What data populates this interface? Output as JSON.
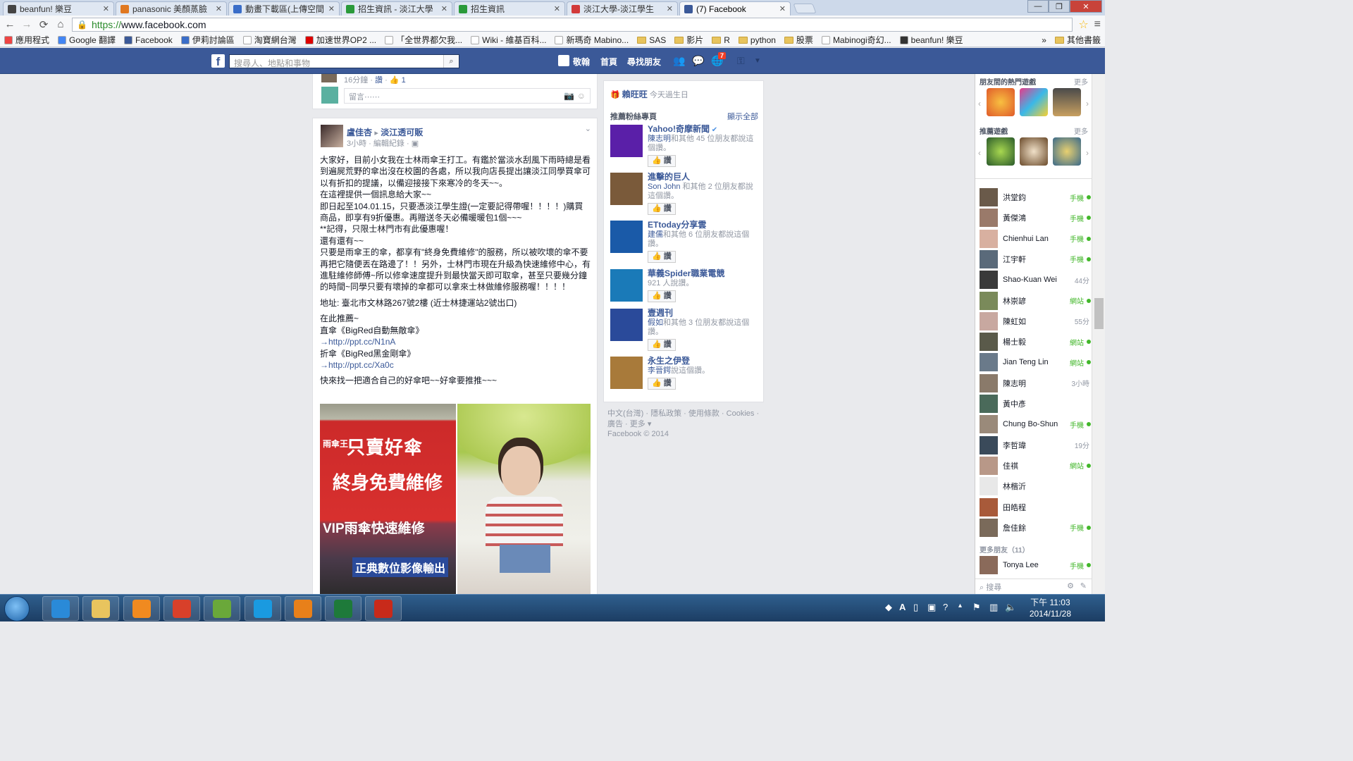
{
  "browser": {
    "tabs": [
      {
        "title": "beanfun! 樂豆",
        "color": "#444"
      },
      {
        "title": "panasonic 美顏蒸臉",
        "color": "#e07820"
      },
      {
        "title": "動畫下載區(上傳空間",
        "color": "#3a6dc8"
      },
      {
        "title": "招生資訊 - 淡江大學",
        "color": "#2a9a3a"
      },
      {
        "title": "招生資訊",
        "color": "#2a9a3a"
      },
      {
        "title": "淡江大學-淡江學生",
        "color": "#d23a3a"
      },
      {
        "title": "(7) Facebook",
        "color": "#3b5998"
      }
    ],
    "url_https": "https://",
    "url_rest": "www.facebook.com",
    "window_buttons": [
      "—",
      "❐",
      "✕"
    ],
    "bookmarks": [
      {
        "label": "應用程式",
        "icon": "apps-icon"
      },
      {
        "label": "Google 翻譯",
        "icon": "google-translate-icon"
      },
      {
        "label": "Facebook",
        "icon": "facebook-icon"
      },
      {
        "label": "伊莉討論區",
        "icon": "eyny-icon"
      },
      {
        "label": "淘寶網台灣",
        "icon": "page-icon"
      },
      {
        "label": "加速世界OP2 ...",
        "icon": "youtube-icon"
      },
      {
        "label": "「全世界都欠我...",
        "icon": "page-icon"
      },
      {
        "label": "Wiki - 維基百科...",
        "icon": "wiki-icon"
      },
      {
        "label": "新瑪奇 Mabino...",
        "icon": "page-icon"
      },
      {
        "label": "SAS",
        "icon": "folder-icon"
      },
      {
        "label": "影片",
        "icon": "folder-icon"
      },
      {
        "label": "R",
        "icon": "folder-icon"
      },
      {
        "label": "python",
        "icon": "folder-icon"
      },
      {
        "label": "股票",
        "icon": "folder-icon"
      },
      {
        "label": "Mabinogi奇幻...",
        "icon": "page-icon"
      },
      {
        "label": "beanfun! 樂豆",
        "icon": "beanfun-icon"
      }
    ],
    "bookmarks_more": "»",
    "other_bookmarks": "其他書籤"
  },
  "fb": {
    "search_placeholder": "搜尋人、地點和事物",
    "nav_user": "敬翰",
    "nav_home": "首頁",
    "nav_find_friends": "尋找朋友",
    "notif_count": "7"
  },
  "prev_post": {
    "time": "16分鐘",
    "like": "讚",
    "like_count": "1",
    "comment_placeholder": "留言⋯⋯"
  },
  "post": {
    "author": "盧佳杏",
    "arrow": "▸",
    "group": "淡江透可販",
    "time": "3小時",
    "edited": "編輯紀錄",
    "paragraphs": [
      "大家好，目前小女我在士林雨傘王打工。有鑑於當淡水刮風下雨時總是看到遍屍荒野的傘出沒在校園的各處，所以我向店長提出讓淡江同學買傘可以有折扣的提議，以備迎接接下來寒冷的冬天~~。",
      "在這裡提供一個訊息給大家~~",
      "即日起至104.01.15，只要憑淡江學生證(一定要記得帶喔！！！！)購買商品，即享有9折優惠。再贈送冬天必備暖暖包1個~~~",
      "**記得，只限士林門市有此優惠喔！",
      "還有還有~~",
      "只要是雨傘王的傘，都享有\"終身免費維修\"的服務，所以被吹壞的傘不要再把它隨便丟在路邊了！！另外，士林門市現在升級為快速維修中心，有進駐維修師傅~所以修傘速度提升到最快當天即可取傘，甚至只要幾分鐘的時間~同學只要有壞掉的傘都可以拿來士林做維修服務喔！！！！"
    ],
    "address": "地址: 臺北市文林路267號2樓 (近士林捷運站2號出口)",
    "recommend": "在此推薦~",
    "item1": "直傘《BigRed自動無敵傘》",
    "link1": "→http://ppt.cc/N1nA",
    "item2": "折傘《BigRed黑金剛傘》",
    "link2": "→http://ppt.cc/Xa0c",
    "closing": "快來找一把適合自己的好傘吧~~好傘要推推~~~",
    "photo_sign_lines": [
      "只賣好傘",
      "終身免費維修",
      "VIP雨傘快速維修",
      "正典數位影像輸出"
    ],
    "photo_sign_brand": "雨傘王"
  },
  "sidebar": {
    "birthday_name": "賴旺旺",
    "birthday_text": "今天過生日",
    "pages_header": "推薦粉絲專頁",
    "show_all": "顯示全部",
    "like_label": "讚",
    "pages": [
      {
        "name": "Yahoo!奇摩新聞",
        "desc_a": "陳志明",
        "desc_b": "和其他 45 位朋友都說這個讚。",
        "color": "#5a1fa8",
        "verified": true
      },
      {
        "name": "進擊的巨人",
        "desc_a": "Son John",
        "desc_b": " 和其他 2 位朋友都說這個讚。",
        "color": "#7a5a3a",
        "verified": false
      },
      {
        "name": "ETtoday分享雲",
        "desc_a": "建儒",
        "desc_b": "和其他 6 位朋友都說這個讚。",
        "color": "#1a5aa8",
        "verified": false
      },
      {
        "name": "華義Spider職業電競",
        "desc_a": "",
        "desc_b": "921 人說讚。",
        "color": "#1a7ab8",
        "verified": false
      },
      {
        "name": "壹週刊",
        "desc_a": "假如",
        "desc_b": "和其他 3 位朋友都說這個讚。",
        "color": "#2a4a9a",
        "verified": false
      },
      {
        "name": "永生之伊登",
        "desc_a": "李晉鍔",
        "desc_b": "說這個讚。",
        "color": "#a87a3a",
        "verified": false
      }
    ]
  },
  "footer": {
    "line1": "中文(台灣) · 隱私政策 · 使用條款 · Cookies ·",
    "line2": "廣告 · 更多 ▾",
    "line3": "Facebook © 2014"
  },
  "chat": {
    "games_header": "朋友間的熱門遊戲",
    "games_more": "更多",
    "rec_games_header": "推薦遊戲",
    "rec_games_more": "更多",
    "friends": [
      {
        "name": "洪堂鈞",
        "status": "手機",
        "active": true
      },
      {
        "name": "黃傑鴻",
        "status": "手機",
        "active": true
      },
      {
        "name": "Chienhui Lan",
        "status": "手機",
        "active": true
      },
      {
        "name": "江宇軒",
        "status": "手機",
        "active": true
      },
      {
        "name": "Shao-Kuan Wei",
        "status": "44分",
        "active": false
      },
      {
        "name": "林崇諺",
        "status": "網站",
        "active": true
      },
      {
        "name": "陳虹如",
        "status": "55分",
        "active": false
      },
      {
        "name": "楊士毅",
        "status": "網站",
        "active": true
      },
      {
        "name": "Jian Teng Lin",
        "status": "網站",
        "active": true
      },
      {
        "name": "陳志明",
        "status": "3小時",
        "active": false
      },
      {
        "name": "黃中彥",
        "status": "",
        "active": false
      },
      {
        "name": "Chung Bo-Shun",
        "status": "手機",
        "active": true
      },
      {
        "name": "李哲瑋",
        "status": "19分",
        "active": false
      },
      {
        "name": "佳祺",
        "status": "網站",
        "active": true
      },
      {
        "name": "林楷沂",
        "status": "",
        "active": false
      },
      {
        "name": "田皓程",
        "status": "",
        "active": false
      },
      {
        "name": "詹佳餘",
        "status": "手機",
        "active": true
      }
    ],
    "more_friends": "更多朋友（11）",
    "extra_friend": {
      "name": "Tonya Lee",
      "status": "手機"
    },
    "search_placeholder": "搜尋"
  },
  "taskbar": {
    "time": "下午 11:03",
    "date": "2014/11/28",
    "apps": [
      {
        "name": "ie-icon",
        "color": "#2a8ad8"
      },
      {
        "name": "explorer-icon",
        "color": "#e8c45e"
      },
      {
        "name": "media-player-icon",
        "color": "#f08a20"
      },
      {
        "name": "chrome-icon",
        "color": "#d8402a"
      },
      {
        "name": "app-icon",
        "color": "#6aa83a"
      },
      {
        "name": "skype-icon",
        "color": "#1a9ae0"
      },
      {
        "name": "app-orange-icon",
        "color": "#e8801a"
      },
      {
        "name": "excel-icon",
        "color": "#1e7a3a"
      },
      {
        "name": "acrobat-icon",
        "color": "#c82a1a"
      }
    ]
  }
}
